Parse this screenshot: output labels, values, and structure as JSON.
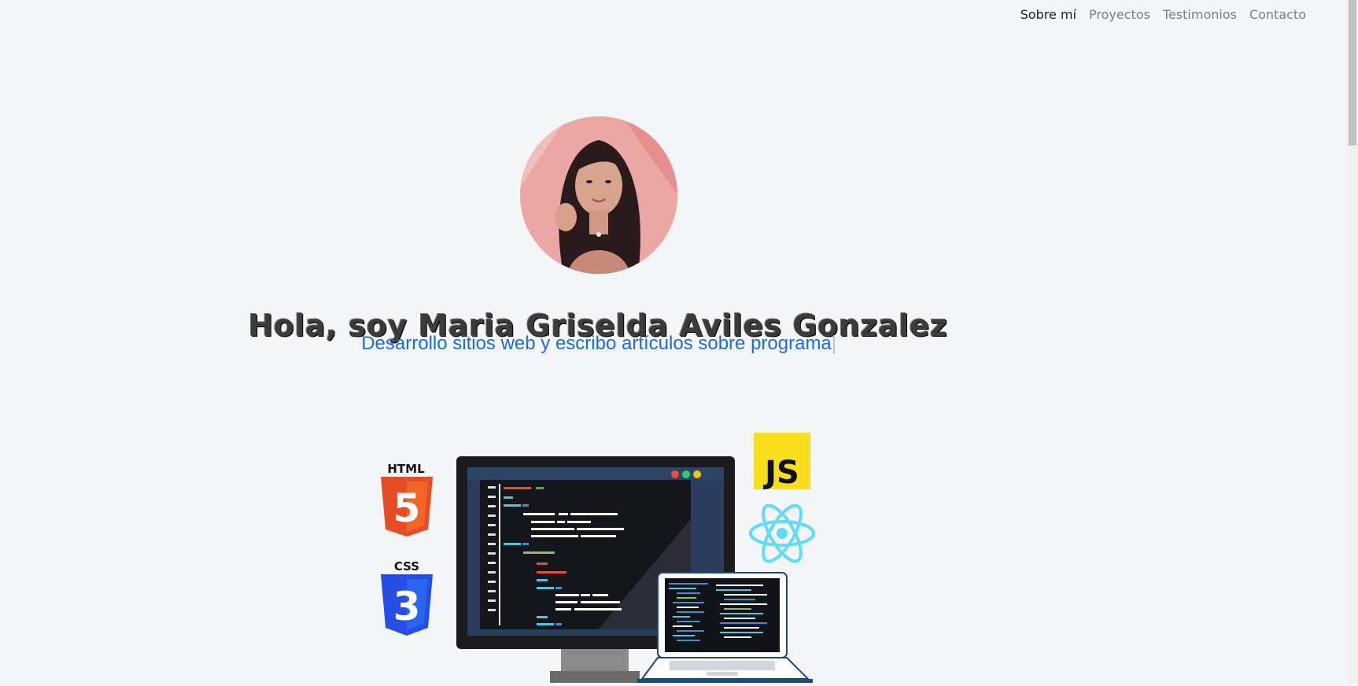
{
  "nav": {
    "items": [
      {
        "label": "Sobre mí",
        "active": true
      },
      {
        "label": "Proyectos",
        "active": false
      },
      {
        "label": "Testimonios",
        "active": false
      },
      {
        "label": "Contacto",
        "active": false
      }
    ]
  },
  "hero": {
    "title": "Hola, soy Maria Griselda Aviles Gonzalez",
    "subtitle": "Desarrollo sitios web y escribo artículos sobre programa"
  },
  "illustration": {
    "html_label": "HTML",
    "html_number": "5",
    "css_label": "CSS",
    "css_number": "3",
    "js_label": "JS"
  },
  "colors": {
    "accent": "#1e6be0",
    "html": "#e44d26",
    "css": "#264de4",
    "js": "#f7df1e",
    "react": "#61dafb"
  }
}
